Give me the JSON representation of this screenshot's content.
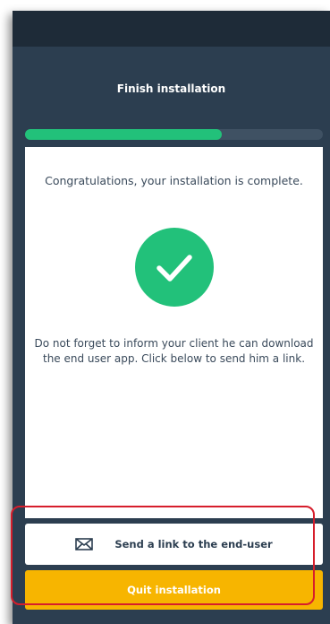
{
  "header": {
    "title": "Finish installation"
  },
  "progress": {
    "fraction": 0.66,
    "track_color": "#3f5163",
    "fill_color": "#22c17a"
  },
  "card": {
    "congrats_text": "Congratulations, your installation is complete.",
    "status_icon": "check-circle-icon",
    "reminder_text": "Do not forget to inform your client he can download the end user app. Click below to send him a link."
  },
  "actions": {
    "send_link_label": "Send a link to the end-user",
    "send_link_icon": "mail-icon",
    "quit_label": "Quit installation",
    "quit_color": "#f7b500"
  },
  "colors": {
    "background": "#2c3e50",
    "success": "#22c17a",
    "highlight_border": "#d61e2c"
  }
}
